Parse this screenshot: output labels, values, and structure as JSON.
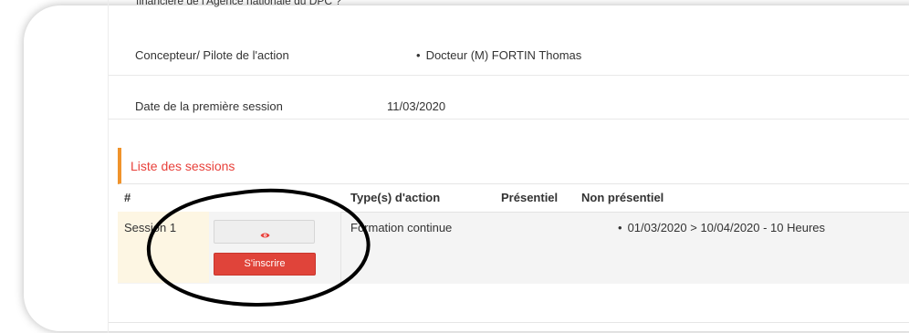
{
  "header_cut_text": "financière de l'Agence nationale du DPC ?",
  "info": {
    "designer_label": "Concepteur/ Pilote de l'action",
    "designer_value": "Docteur (M) FORTIN Thomas",
    "first_session_label": "Date de la première session",
    "first_session_value": "11/03/2020"
  },
  "sessions": {
    "title": "Liste des sessions",
    "accent_color": "#e8413b",
    "border_color": "#f0932b",
    "columns": {
      "number": "#",
      "types": "Type(s) d'action",
      "presentiel": "Présentiel",
      "non_presentiel": "Non présentiel"
    },
    "rows": [
      {
        "name": "Session 1",
        "type": "Formation continue",
        "presentiel": "",
        "non_presentiel": "01/03/2020 > 10/04/2020 - 10 Heures",
        "view_icon": "eye-icon",
        "register_label": "S'inscrire"
      }
    ]
  }
}
